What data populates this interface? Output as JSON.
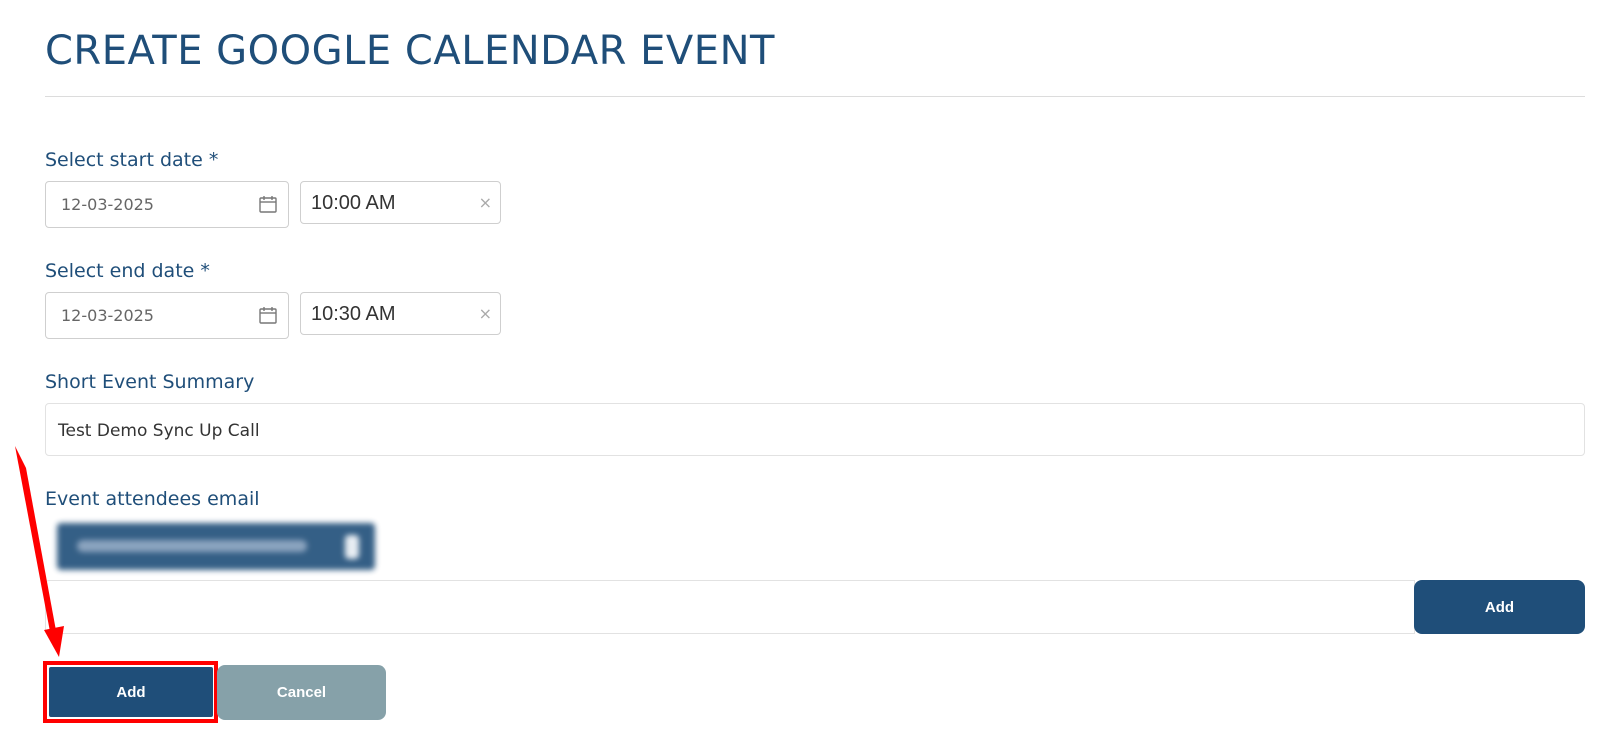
{
  "page": {
    "title": "CREATE GOOGLE CALENDAR EVENT"
  },
  "start": {
    "label": "Select start date *",
    "date": "12-03-2025",
    "time": "10:00 AM",
    "clear_glyph": "×"
  },
  "end": {
    "label": "Select end date *",
    "date": "12-03-2025",
    "time": "10:30 AM",
    "clear_glyph": "×"
  },
  "summary": {
    "label": "Short Event Summary",
    "value": "Test Demo Sync Up Call"
  },
  "attendees": {
    "label": "Event attendees email",
    "input_value": "",
    "add_label": "Add"
  },
  "actions": {
    "add_label": "Add",
    "cancel_label": "Cancel"
  },
  "colors": {
    "primary": "#1f4e79",
    "cancel": "#86a1a9",
    "highlight": "#ff0000"
  },
  "icons": {
    "date_picker": "calendar-icon",
    "clear": "clear-icon"
  }
}
